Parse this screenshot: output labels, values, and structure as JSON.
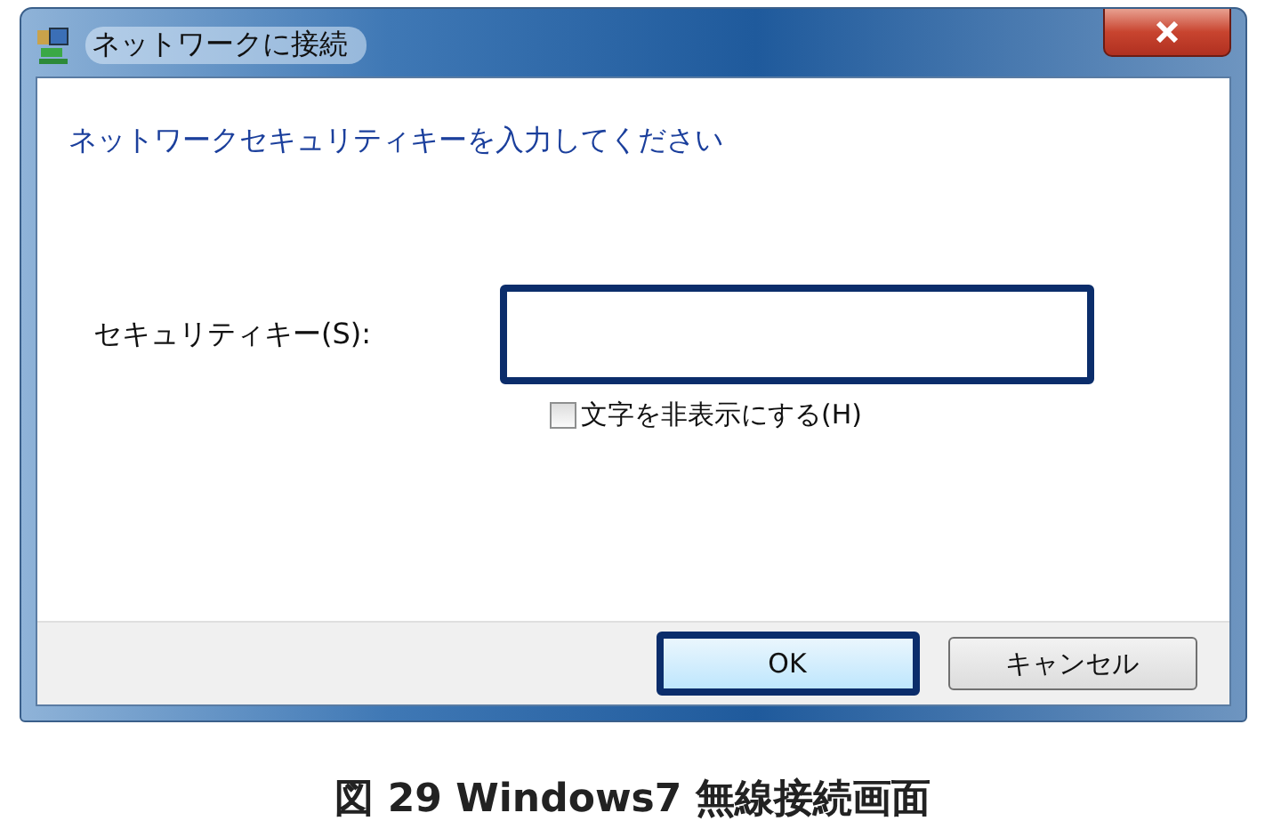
{
  "window": {
    "title": "ネットワークに接続"
  },
  "instruction": "ネットワークセキュリティキーを入力してください",
  "security_key": {
    "label": "セキュリティキー(S):"
  },
  "hide_characters": {
    "label": "文字を非表示にする(H)",
    "checked": false
  },
  "buttons": [
    {
      "label": "OK",
      "kind": "default"
    },
    {
      "label": "キャンセル",
      "kind": "normal"
    }
  ],
  "caption": "図 29 Windows7 無線接続画面"
}
